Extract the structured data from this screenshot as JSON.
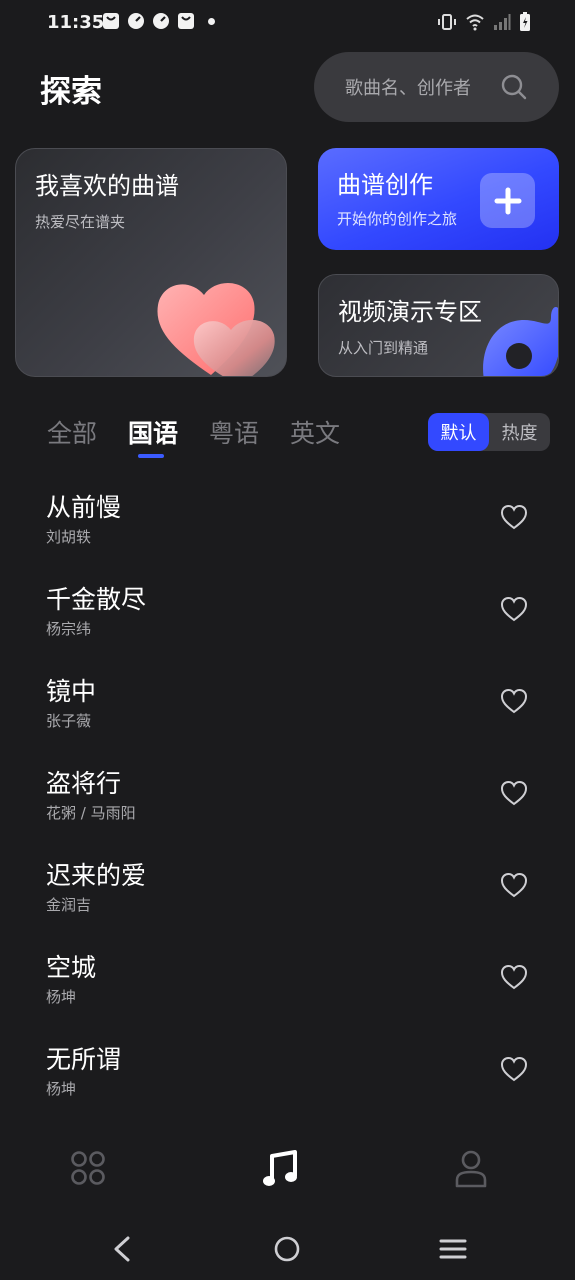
{
  "status": {
    "time": "11:35"
  },
  "header": {
    "title": "探索",
    "search_placeholder": "歌曲名、创作者"
  },
  "cards": {
    "favorites": {
      "title": "我喜欢的曲谱",
      "subtitle": "热爱尽在谱夹"
    },
    "create": {
      "title": "曲谱创作",
      "subtitle": "开始你的创作之旅"
    },
    "video": {
      "title": "视频演示专区",
      "subtitle": "从入门到精通"
    }
  },
  "tabs": [
    {
      "label": "全部",
      "active": false
    },
    {
      "label": "国语",
      "active": true
    },
    {
      "label": "粤语",
      "active": false
    },
    {
      "label": "英文",
      "active": false
    }
  ],
  "sort": {
    "default": "默认",
    "popular": "热度",
    "selected": "默认"
  },
  "songs": [
    {
      "title": "从前慢",
      "artist": "刘胡轶"
    },
    {
      "title": "千金散尽",
      "artist": "杨宗纬"
    },
    {
      "title": "镜中",
      "artist": "张子薇"
    },
    {
      "title": "盗将行",
      "artist": "花粥 / 马雨阳"
    },
    {
      "title": "迟来的爱",
      "artist": "金润吉"
    },
    {
      "title": "空城",
      "artist": "杨坤"
    },
    {
      "title": "无所谓",
      "artist": "杨坤"
    }
  ],
  "bottom_nav": [
    {
      "icon": "grid-icon",
      "active": false
    },
    {
      "icon": "music-note-icon",
      "active": true
    },
    {
      "icon": "person-icon",
      "active": false
    }
  ],
  "colors": {
    "accent": "#3349ff",
    "background": "#1b1b1d"
  }
}
